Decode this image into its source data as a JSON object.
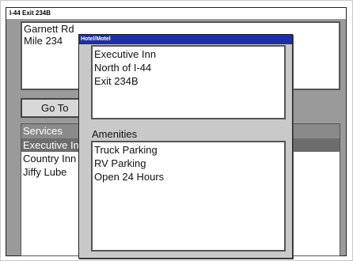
{
  "window": {
    "title": "I-44 Exit 234B"
  },
  "location_box": {
    "lines": [
      "Garnett Rd",
      "Mile 234"
    ]
  },
  "goto_button": {
    "label": "Go To"
  },
  "services": {
    "header": "Services",
    "items": [
      {
        "label": "Executive Inn",
        "selected": true
      },
      {
        "label": "Country Inn",
        "selected": false
      },
      {
        "label": "Jiffy Lube",
        "selected": false
      }
    ]
  },
  "popup": {
    "title": "Hotel/Motel",
    "details": [
      "Executive Inn",
      "North of I-44",
      "Exit 234B"
    ],
    "amenities_label": "Amenities",
    "amenities": [
      "Truck Parking",
      "RV Parking",
      "Open 24 Hours"
    ]
  }
}
